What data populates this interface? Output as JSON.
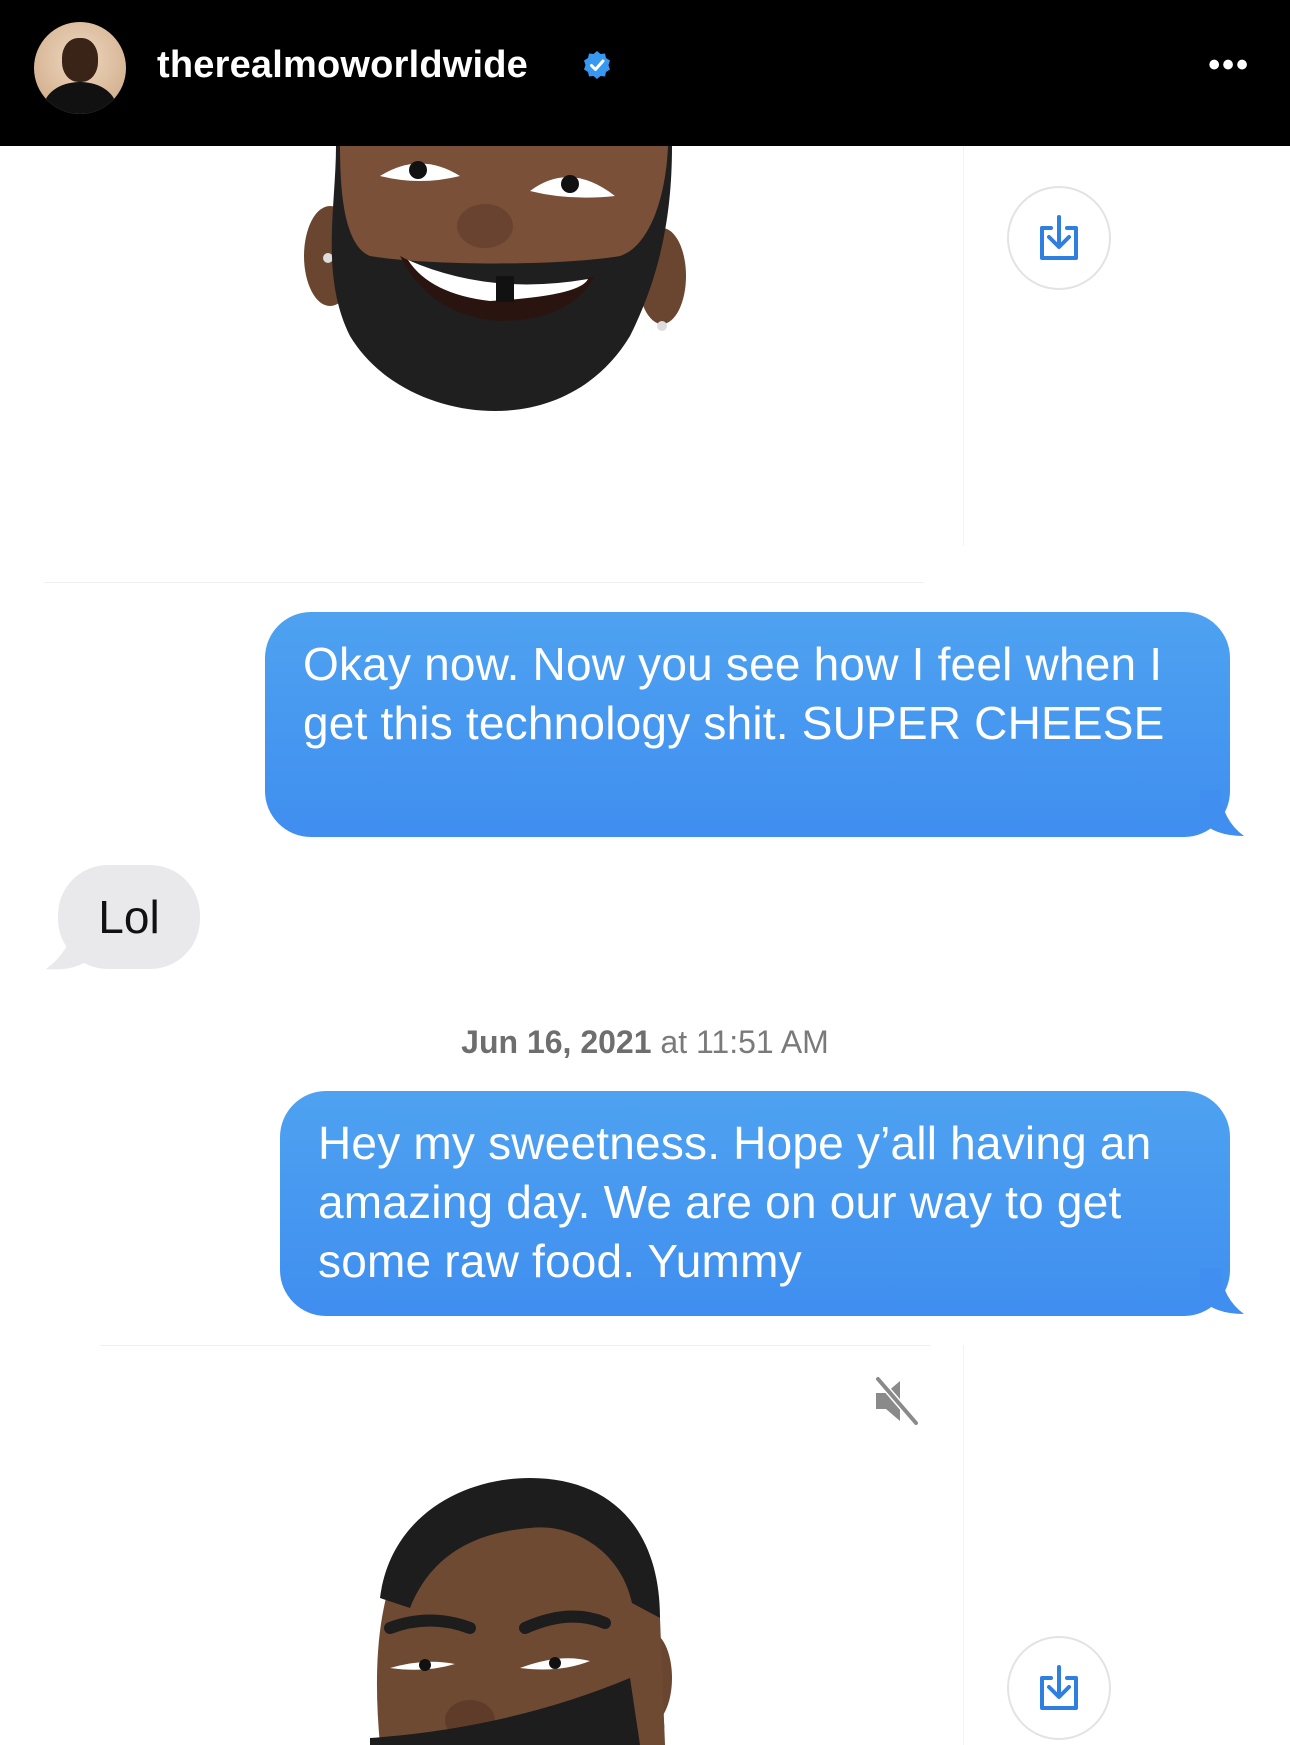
{
  "header": {
    "username": "therealmoworldwide",
    "verified_icon": "verified-badge-icon",
    "more_label": "•••"
  },
  "messages": [
    {
      "kind": "memoji",
      "from": "them"
    },
    {
      "kind": "text",
      "from": "me",
      "text": "Okay now. Now you see how I feel when I get this technology shit. SUPER CHEESE"
    },
    {
      "kind": "text",
      "from": "them",
      "text": "Lol"
    },
    {
      "kind": "timestamp",
      "date": "Jun 16, 2021",
      "at": " at 11:51 AM"
    },
    {
      "kind": "text",
      "from": "me",
      "text": "Hey my sweetness. Hope y’all having an amazing day. We are on our way to get some raw food. Yummy"
    },
    {
      "kind": "memoji",
      "from": "them"
    }
  ],
  "colors": {
    "outgoing": "#3f8ef0",
    "incoming": "#e9e9eb",
    "topbar": "#000000",
    "verified": "#3897f0"
  }
}
